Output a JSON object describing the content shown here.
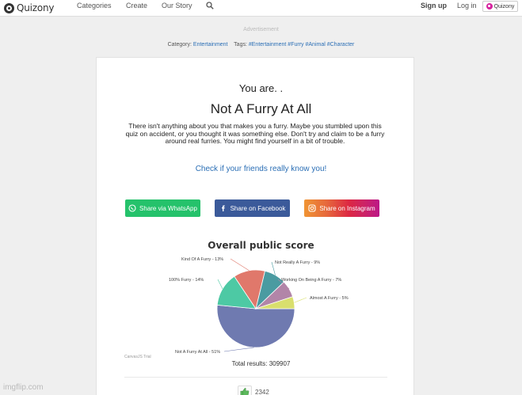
{
  "nav": {
    "logo": "Quizony",
    "links": [
      "Categories",
      "Create",
      "Our Story"
    ],
    "signup": "Sign up",
    "login": "Log in",
    "brand_button": "Quizony"
  },
  "advertisement": "Advertisement",
  "meta": {
    "category_label": "Category:",
    "category": "Entertainment",
    "tags_label": "Tags:",
    "tags": [
      "#Entertainment",
      "#Furry",
      "#Animal",
      "#Character"
    ]
  },
  "result": {
    "you_are": "You are. .",
    "title": "Not A Furry At All",
    "description": "There isn't anything about you that makes you a furry. Maybe you stumbled upon this quiz on accident, or you thought it was something else. Don't try and claim to be a furry around real furries. You might find yourself in a bit of trouble.",
    "check_friends": "Check if your friends really know you!"
  },
  "share": {
    "whatsapp": "Share via WhatsApp",
    "facebook": "Share on Facebook",
    "instagram": "Share on Instagram"
  },
  "colors": {
    "whatsapp": "#25c26b",
    "facebook": "#3b5a9a",
    "link": "#2a6eb5"
  },
  "chart_data": {
    "type": "pie",
    "title": "Overall public score",
    "slices": [
      {
        "label": "Not A Furry At All - 51%",
        "value": 51,
        "color": "#6f7ab0"
      },
      {
        "label": "100% Furry - 14%",
        "value": 14,
        "color": "#4dc9a4"
      },
      {
        "label": "Kind Of A Furry - 13%",
        "value": 13,
        "color": "#e0786b"
      },
      {
        "label": "Not Really A Furry - 9%",
        "value": 9,
        "color": "#4a9ba1"
      },
      {
        "label": "Working On Being A Furry - 7%",
        "value": 7,
        "color": "#b285a8"
      },
      {
        "label": "Almost A Furry - 5%",
        "value": 5,
        "color": "#d9df6d"
      }
    ]
  },
  "total_results": "Total results: 309907",
  "chart_credit": "CanvasJS Trial",
  "likes": "2342",
  "watermark": "imgflip.com"
}
